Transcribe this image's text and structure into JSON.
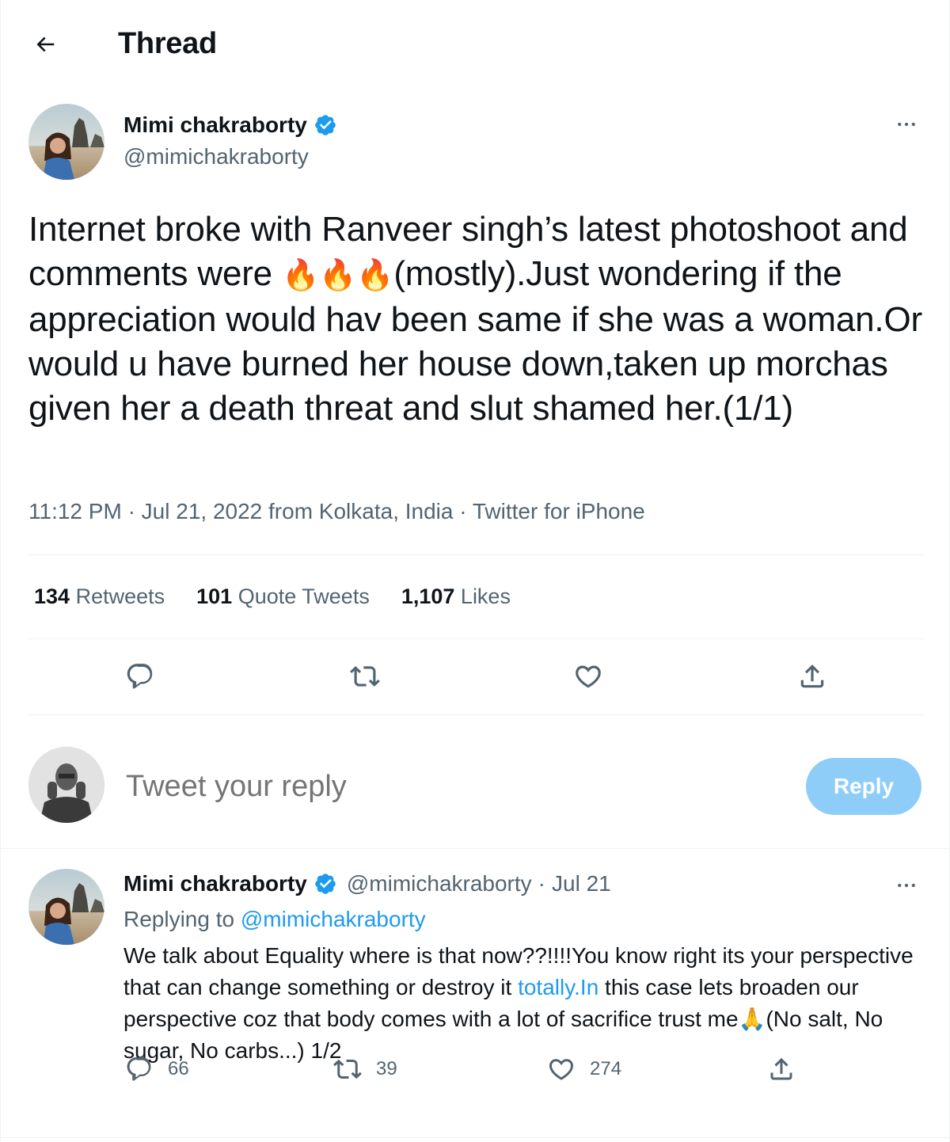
{
  "header": {
    "title": "Thread"
  },
  "main_tweet": {
    "author_name": "Mimi chakraborty",
    "author_handle": "@mimichakraborty",
    "text_part1": "Internet broke with Ranveer singh’s latest photoshoot and comments were ",
    "emoji": "🔥🔥🔥",
    "text_part2": "(mostly).Just wondering if the appreciation would hav been same if she was a woman.Or would  u have burned her house down,taken up morchas given her a death threat and slut shamed her.(1/1)",
    "time": "11:12 PM",
    "date": "Jul 21, 2022",
    "location": "from Kolkata, India",
    "source": "Twitter for iPhone",
    "retweets_count": "134",
    "retweets_label": "Retweets",
    "quote_count": "101",
    "quote_label": "Quote Tweets",
    "likes_count": "1,107",
    "likes_label": "Likes"
  },
  "reply_box": {
    "placeholder": "Tweet your reply",
    "button_label": "Reply"
  },
  "reply_tweet": {
    "author_name": "Mimi chakraborty",
    "author_handle": "@mimichakraborty",
    "date": "Jul 21",
    "replying_label": "Replying to",
    "replying_to": "@mimichakraborty",
    "text_part1": "We talk about Equality where is that now??!!!!You know right its your perspective that can change something  or destroy it ",
    "link_text": "totally.In",
    "text_part2": " this case lets broaden our perspective coz that body comes with a lot of sacrifice trust me",
    "emoji": "🙏",
    "text_part3": "(No salt, No sugar, No carbs...) 1/2",
    "replies_count": "66",
    "retweets_count": "39",
    "likes_count": "274"
  },
  "colors": {
    "accent": "#1d9bf0",
    "secondary_text": "#536471",
    "reply_button_disabled": "#8ecdf8",
    "divider": "#eff3f4"
  }
}
